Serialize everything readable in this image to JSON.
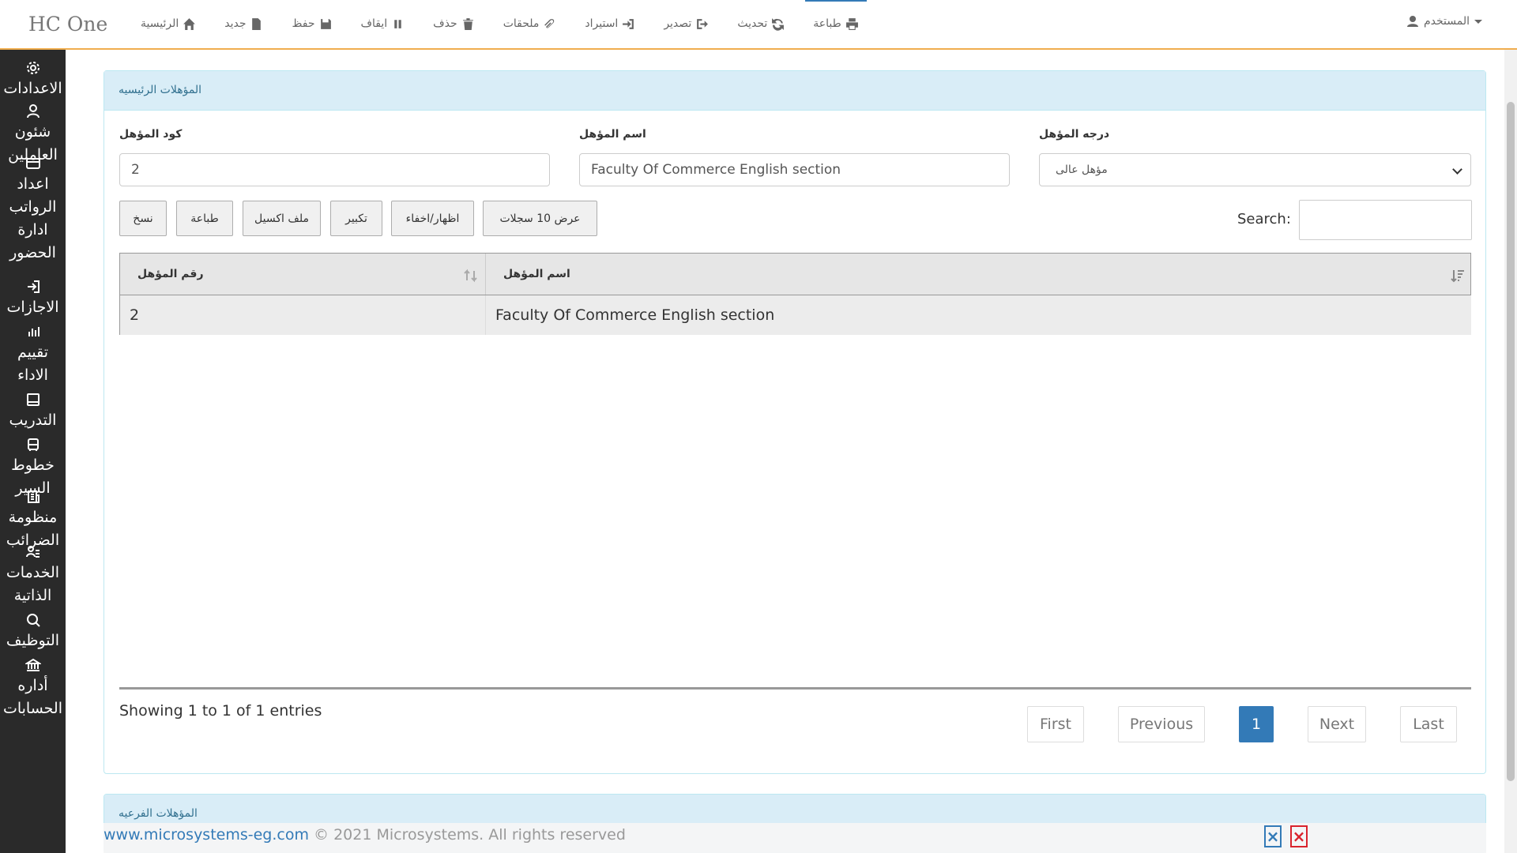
{
  "brand": "HC One",
  "nav": [
    {
      "label": "الرئيسية",
      "icon": "home-icon"
    },
    {
      "label": "جديد",
      "icon": "file-icon"
    },
    {
      "label": "حفظ",
      "icon": "save-icon"
    },
    {
      "label": "ايقاف",
      "icon": "pause-icon"
    },
    {
      "label": "حذف",
      "icon": "trash-icon"
    },
    {
      "label": "ملحقات",
      "icon": "paperclip-icon"
    },
    {
      "label": "استيراد",
      "icon": "import-icon"
    },
    {
      "label": "تصدير",
      "icon": "export-icon"
    },
    {
      "label": "تحديث",
      "icon": "refresh-icon"
    },
    {
      "label": "طباعة",
      "icon": "print-icon"
    }
  ],
  "user": {
    "label": "المستخدم"
  },
  "sidebar": [
    {
      "label": "الاعدادات",
      "icon": "gear-icon"
    },
    {
      "label": "شئون العاملين",
      "icon": "user-icon"
    },
    {
      "label": "اعداد الرواتب",
      "icon": "wallet-icon"
    },
    {
      "label": "ادارة الحضور",
      "icon": "clock-icon"
    },
    {
      "label": "الاجازات",
      "icon": "sign-out-icon"
    },
    {
      "label": "تقييم الاداء",
      "icon": "bar-chart-icon"
    },
    {
      "label": "التدريب",
      "icon": "book-icon"
    },
    {
      "label": "خطوط السير",
      "icon": "bus-icon"
    },
    {
      "label": "منظومة الضرائب",
      "icon": "receipt-icon"
    },
    {
      "label": "الخدمات الذاتية",
      "icon": "users-icon"
    },
    {
      "label": "التوظيف",
      "icon": "search-icon"
    },
    {
      "label": "أداره الحسابات",
      "icon": "bank-icon"
    }
  ],
  "panel": {
    "title": "المؤهلات الرئيسيه",
    "fields": {
      "code_label": "كود المؤهل",
      "code_value": "2",
      "name_label": "اسم المؤهل",
      "name_value": "Faculty Of Commerce English section",
      "degree_label": "درجه المؤهل",
      "degree_value": "مؤهل عالى"
    },
    "buttons": {
      "copy": "نسخ",
      "print": "طباعة",
      "excel": "ملف اكسيل",
      "zoom": "تكبير",
      "toggle": "اظهار/اخفاء",
      "show": "عرض 10 سجلات"
    },
    "search_label": "Search:",
    "table": {
      "headers": {
        "num": "رقم المؤهل",
        "name": "اسم المؤهل"
      },
      "rows": [
        {
          "num": "2",
          "name": "Faculty Of Commerce English section"
        }
      ]
    },
    "info": "Showing 1 to 1 of 1 entries",
    "pager": {
      "first": "First",
      "previous": "Previous",
      "current": "1",
      "next": "Next",
      "last": "Last"
    }
  },
  "panel2": {
    "title": "المؤهلات الفرعيه"
  },
  "footer": {
    "link": "www.microsystems-eg.com",
    "text": " © 2021 Microsystems. All rights reserved"
  },
  "colors": {
    "accent": "#337ab7",
    "nav_border": "#f0ad4e",
    "sidebar_bg": "#2a2a2a",
    "panel_heading": "#d9edf7"
  }
}
